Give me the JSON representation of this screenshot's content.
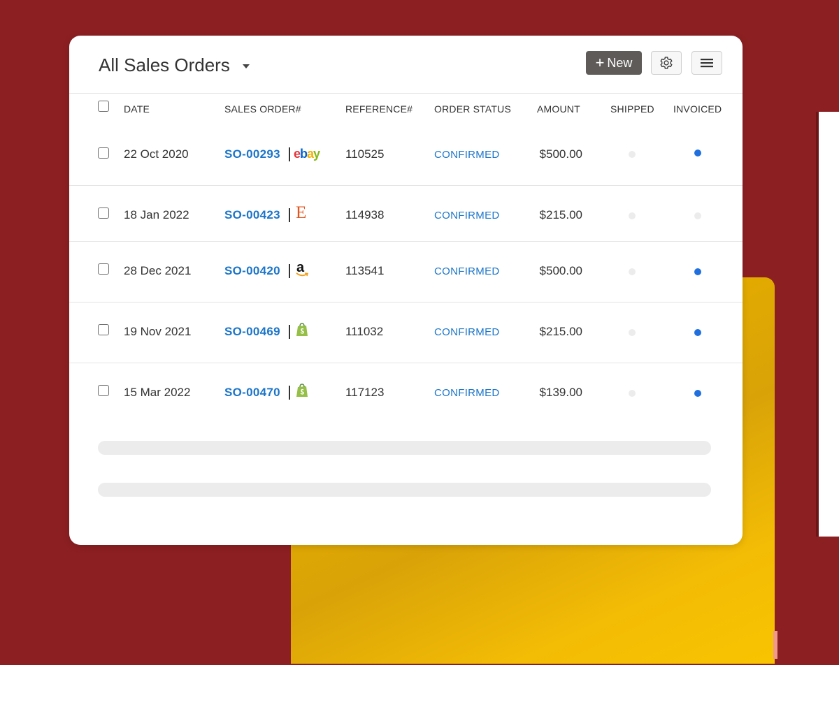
{
  "header": {
    "title": "All Sales Orders",
    "new_button_label": "New",
    "settings_icon": "gear-icon",
    "menu_icon": "hamburger-menu-icon"
  },
  "table": {
    "columns": [
      "DATE",
      "SALES ORDER#",
      "REFERENCE#",
      "ORDER STATUS",
      "AMOUNT",
      "SHIPPED",
      "INVOICED"
    ],
    "rows": [
      {
        "date": "22 Oct 2020",
        "order": "SO-00293",
        "channel": "ebay",
        "reference": "110525",
        "status": "CONFIRMED",
        "amount": "$500.00",
        "shipped": false,
        "invoiced": true
      },
      {
        "date": "18 Jan 2022",
        "order": "SO-00423",
        "channel": "etsy",
        "reference": "114938",
        "status": "CONFIRMED",
        "amount": "$215.00",
        "shipped": false,
        "invoiced": false
      },
      {
        "date": "28 Dec 2021",
        "order": "SO-00420",
        "channel": "amazon",
        "reference": "113541",
        "status": "CONFIRMED",
        "amount": "$500.00",
        "shipped": false,
        "invoiced": true
      },
      {
        "date": "19 Nov 2021",
        "order": "SO-00469",
        "channel": "shopify",
        "reference": "111032",
        "status": "CONFIRMED",
        "amount": "$215.00",
        "shipped": false,
        "invoiced": true
      },
      {
        "date": "15 Mar 2022",
        "order": "SO-00470",
        "channel": "shopify",
        "reference": "117123",
        "status": "CONFIRMED",
        "amount": "$139.00",
        "shipped": false,
        "invoiced": true
      }
    ]
  },
  "logos": {
    "ebay_text": "ebay",
    "etsy_text": "E",
    "amazon_text": "a"
  },
  "colors": {
    "link": "#1b75c9",
    "invoiced_dot": "#1f6fde",
    "background": "#8c1f22",
    "accent_yellow": "#f6bd0a"
  }
}
